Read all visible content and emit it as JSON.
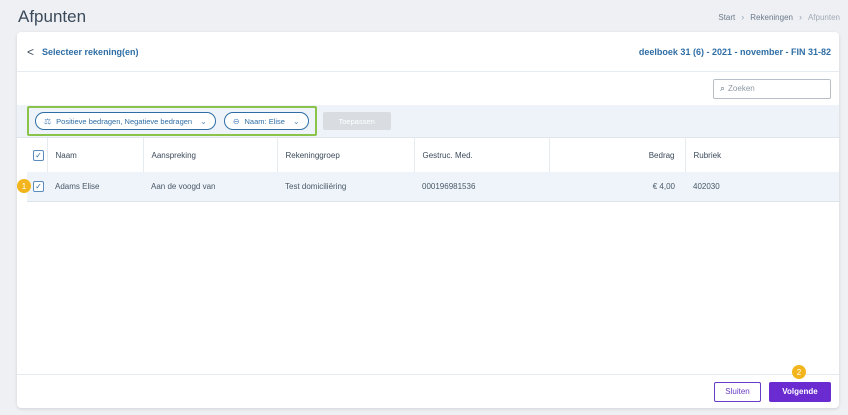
{
  "header": {
    "title": "Afpunten",
    "breadcrumb": [
      "Start",
      "Rekeningen",
      "Afpunten"
    ]
  },
  "card": {
    "back_label": "Selecteer rekening(en)",
    "ledger_label": "deelboek 31 (6) - 2021 - november - FIN 31-82"
  },
  "search": {
    "placeholder": "Zoeken"
  },
  "filters": {
    "chips": [
      {
        "label": "Positieve bedragen, Negatieve bedragen",
        "icon": "amount-filter-icon"
      },
      {
        "label": "Naam: Elise",
        "icon": "tag-icon"
      }
    ],
    "apply_label": "Toepassen"
  },
  "table": {
    "columns": [
      "Naam",
      "Aanspreking",
      "Rekeninggroep",
      "Gestruc. Med.",
      "Bedrag",
      "Rubriek"
    ],
    "rows": [
      {
        "checked": true,
        "naam": "Adams Elise",
        "aanspreking": "Aan de voogd van",
        "rekeninggroep": "Test domiciliëring",
        "gestruc_med": "000196981536",
        "bedrag": "€ 4,00",
        "rubriek": "402030"
      }
    ]
  },
  "badges": [
    "1",
    "2"
  ],
  "footer": {
    "close_label": "Sluiten",
    "next_label": "Volgende"
  },
  "colors": {
    "accent_blue": "#2f6ea5",
    "primary_purple": "#6a2bd0",
    "highlight_green": "#8bc34a",
    "badge_yellow": "#f2b51d"
  }
}
